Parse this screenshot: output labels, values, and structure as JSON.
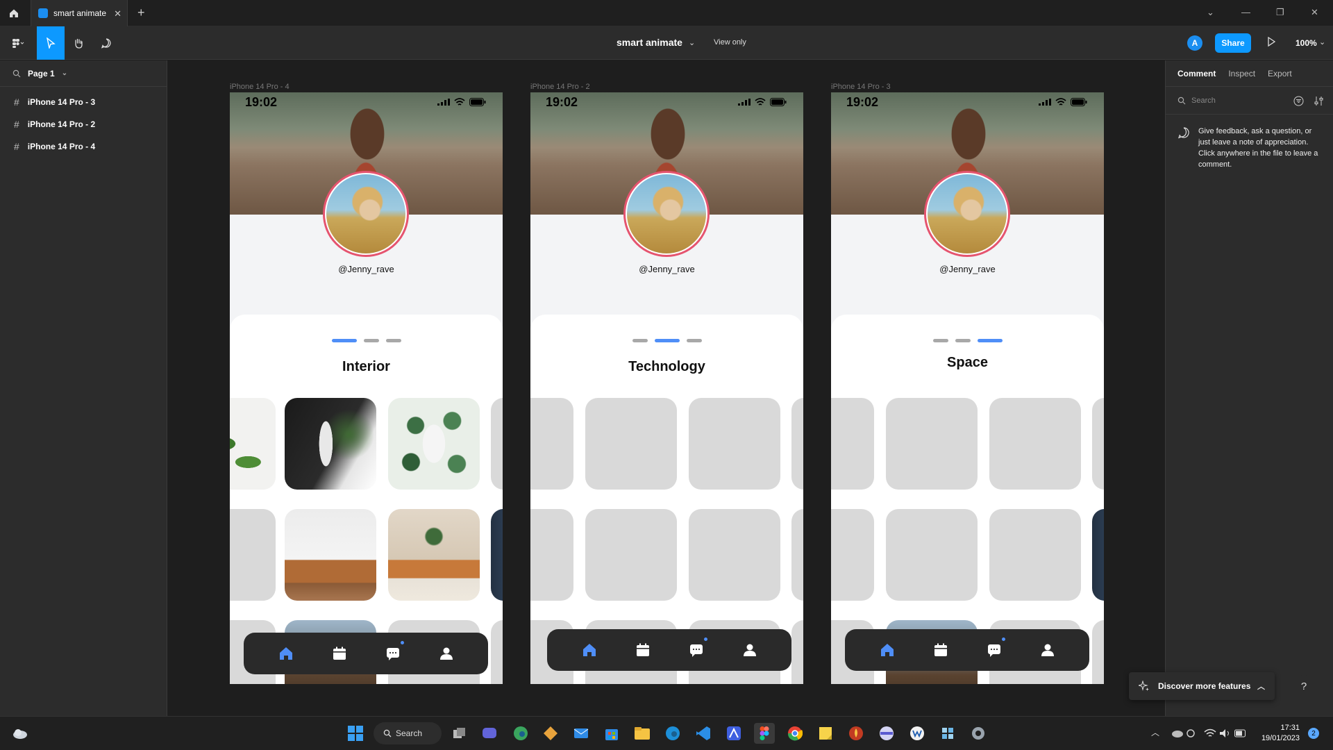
{
  "tabbar": {
    "tab_title": "smart animate"
  },
  "toolbar": {
    "doc_title": "smart animate",
    "view_only": "View only",
    "avatar_initial": "A",
    "share_label": "Share",
    "zoom": "100%"
  },
  "left_panel": {
    "page": "Page 1",
    "layers": [
      "iPhone 14 Pro - 3",
      "iPhone 14 Pro - 2",
      "iPhone 14 Pro - 4"
    ]
  },
  "right_panel": {
    "tabs": [
      "Comment",
      "Inspect",
      "Export"
    ],
    "search_placeholder": "Search",
    "hint": "Give feedback, ask a question, or just leave a note of appreciation. Click anywhere in the file to leave a comment."
  },
  "frames": [
    {
      "label": "iPhone 14 Pro - 4",
      "time": "19:02",
      "username": "@Jenny_rave",
      "title": "Interior",
      "active_dot": 0
    },
    {
      "label": "iPhone 14 Pro - 2",
      "time": "19:02",
      "username": "@Jenny_rave",
      "title": "Technology",
      "active_dot": 1
    },
    {
      "label": "iPhone 14 Pro - 3",
      "time": "19:02",
      "username": "@Jenny_rave",
      "title": "Space",
      "active_dot": 2
    }
  ],
  "discover": {
    "label": "Discover more features"
  },
  "help": {
    "label": "?"
  },
  "taskbar": {
    "search_label": "Search",
    "time": "17:31",
    "date": "19/01/2023",
    "notifications": "2"
  },
  "colors": {
    "accent": "#0d99ff",
    "dot_active": "#4f8ef7",
    "avatar_ring": "#e5546f"
  }
}
